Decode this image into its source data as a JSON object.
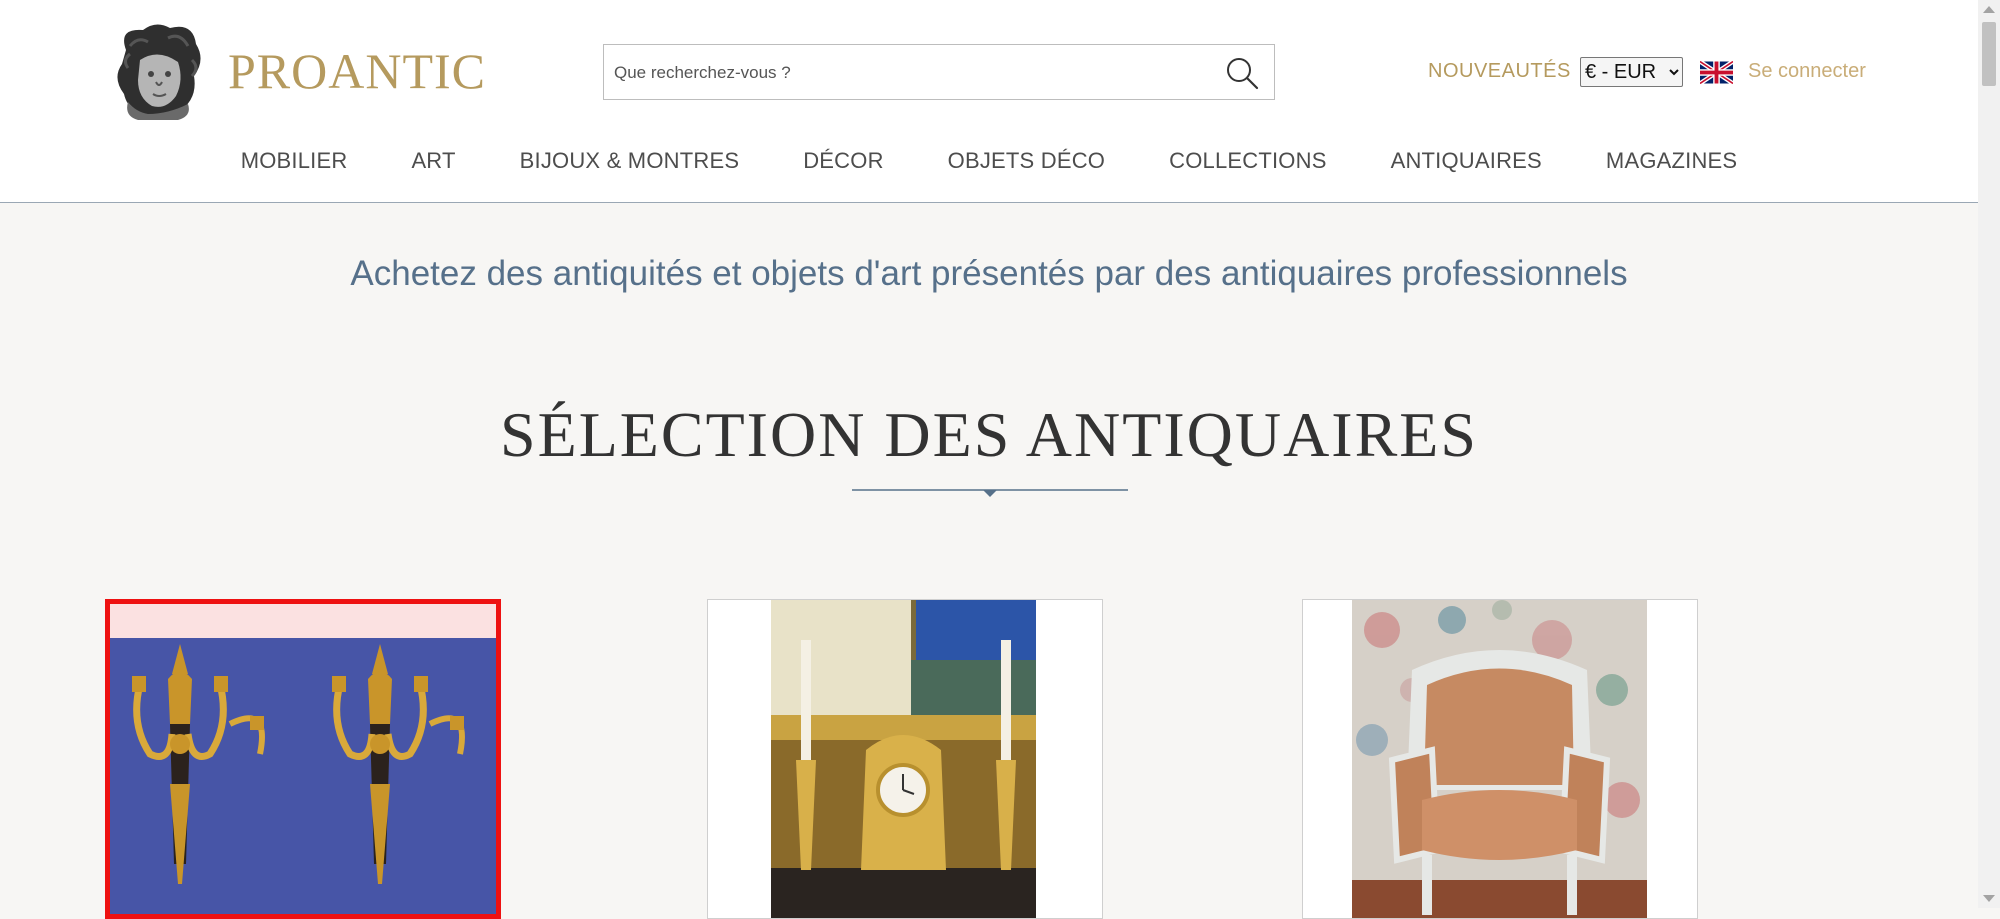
{
  "brand": {
    "name": "PROANTIC",
    "color": "#b59a5e"
  },
  "search": {
    "placeholder": "Que recherchez-vous ?",
    "icon": "search-icon"
  },
  "header": {
    "nouveautes": "NOUVEAUTÉS",
    "currency": {
      "selected": "€ - EUR",
      "options": [
        "€ - EUR"
      ]
    },
    "language_icon": "uk-flag-icon",
    "login": "Se connecter"
  },
  "nav": {
    "items": [
      "MOBILIER",
      "ART",
      "BIJOUX & MONTRES",
      "DÉCOR",
      "OBJETS DÉCO",
      "COLLECTIONS",
      "ANTIQUAIRES",
      "MAGAZINES"
    ]
  },
  "tagline": "Achetez des antiquités et objets d'art présentés par des antiquaires professionnels",
  "section": {
    "title": "SÉLECTION DES ANTIQUAIRES"
  },
  "products": [
    {
      "name": "ormolu-wall-sconces",
      "selected": true
    },
    {
      "name": "gilt-clock-garniture",
      "selected": false
    },
    {
      "name": "louis-xvi-bergere",
      "selected": false
    }
  ],
  "colors": {
    "accent": "#b59a5e",
    "tagline": "#56708a",
    "selection": "#ee1111"
  }
}
